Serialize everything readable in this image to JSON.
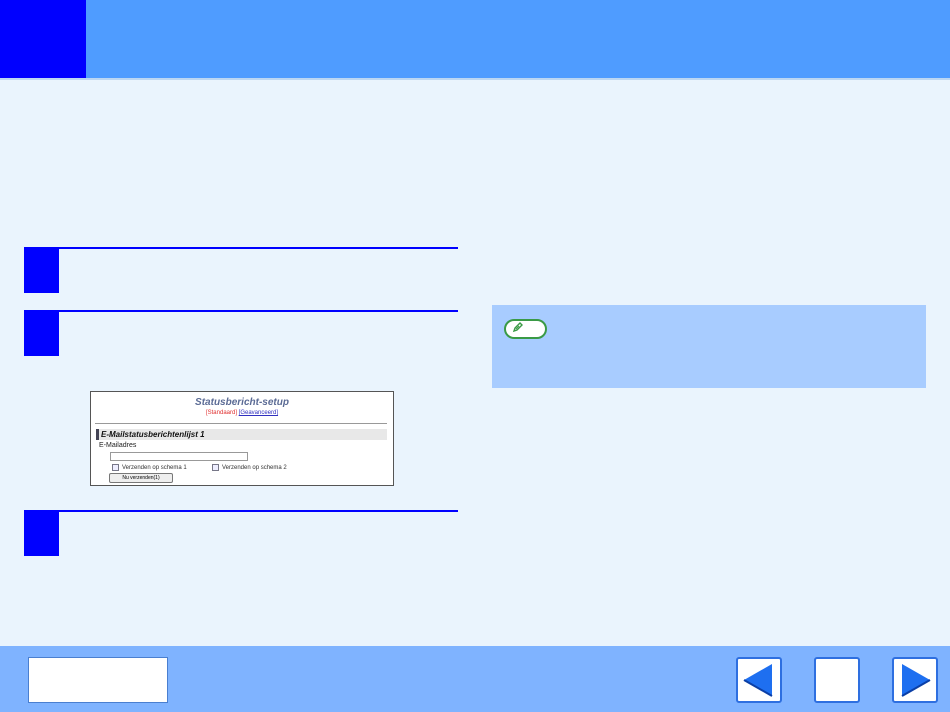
{
  "screenshot": {
    "title": "Statusbericht-setup",
    "link_standard": "[Standaard]",
    "link_advanced": "[Geavanceerd]",
    "section_heading": "E-Mailstatusberichtenlijst 1",
    "email_label": "E-Mailadres",
    "email_value": "",
    "checkbox_schedule_1": "Verzenden op schema 1",
    "checkbox_schedule_2": "Verzenden op schema 2",
    "send_now_button": "Nu verzenden(1)"
  },
  "colors": {
    "header": "#4f9cff",
    "accent_blue": "#0000ff",
    "note_box": "#a8ccff",
    "footer": "#7fb3ff",
    "background": "#eaf4fd"
  },
  "icons": {
    "note": "pencil-note-icon",
    "prev": "left-arrow-icon",
    "next": "right-arrow-icon"
  }
}
